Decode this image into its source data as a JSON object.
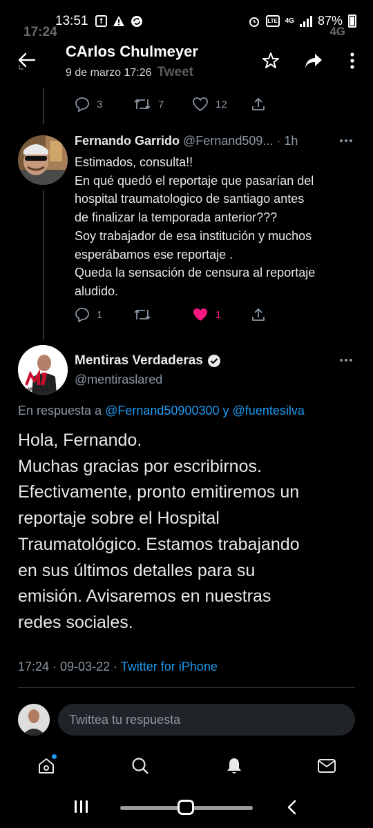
{
  "status_bar": {
    "time": "13:51",
    "time_ghost": "17:24",
    "battery": "87%",
    "network": "4G",
    "network_ghost": "4G"
  },
  "header": {
    "title": "CArlos Chulmeyer",
    "subtitle": "9 de marzo 17:26",
    "subtitle_ghost": "Tweet"
  },
  "prev_tweet_actions": {
    "replies": "3",
    "retweets": "7",
    "likes": "12"
  },
  "tweet1": {
    "name": "Fernando Garrido",
    "handle": "@Fernand509...",
    "time": "· 1h",
    "text_lines": [
      "Estimados,  consulta!!",
      "En qué quedó el reportaje que pasarían del",
      "hospital traumatologico de santiago antes",
      "de finalizar la temporada anterior???",
      "Soy trabajador de esa institución y muchos",
      "esperábamos ese reportaje .",
      "Queda la sensación de censura al reportaje",
      "aludido."
    ],
    "actions": {
      "replies": "1",
      "retweets": "",
      "likes": "1"
    },
    "like_color": "#f91880"
  },
  "tweet2": {
    "name": "Mentiras Verdaderas",
    "handle": "@mentiraslared",
    "reply_prefix": "En respuesta a",
    "reply_user1": "@Fernand50900300",
    "reply_and": "y",
    "reply_user2": "@fuentesilva",
    "text_lines": [
      "Hola, Fernando.",
      "Muchas gracias por escribirnos.",
      "Efectivamente, pronto emitiremos un",
      "reportaje sobre el Hospital",
      "Traumatológico. Estamos trabajando",
      "en sus últimos detalles para su",
      "emisión. Avisaremos en nuestras",
      "redes sociales."
    ],
    "timestamp": "17:24 · 09-03-22 ·",
    "source": "Twitter for iPhone",
    "logo_text": "MENTIRAS"
  },
  "reply_box": {
    "placeholder": "Twittea tu respuesta"
  },
  "colors": {
    "accent": "#1d9bf0",
    "background": "#000000",
    "muted": "#8b98a5",
    "like": "#f91880"
  },
  "nav": {
    "items": [
      "home-icon",
      "search-icon",
      "bell-icon",
      "mail-icon"
    ]
  }
}
